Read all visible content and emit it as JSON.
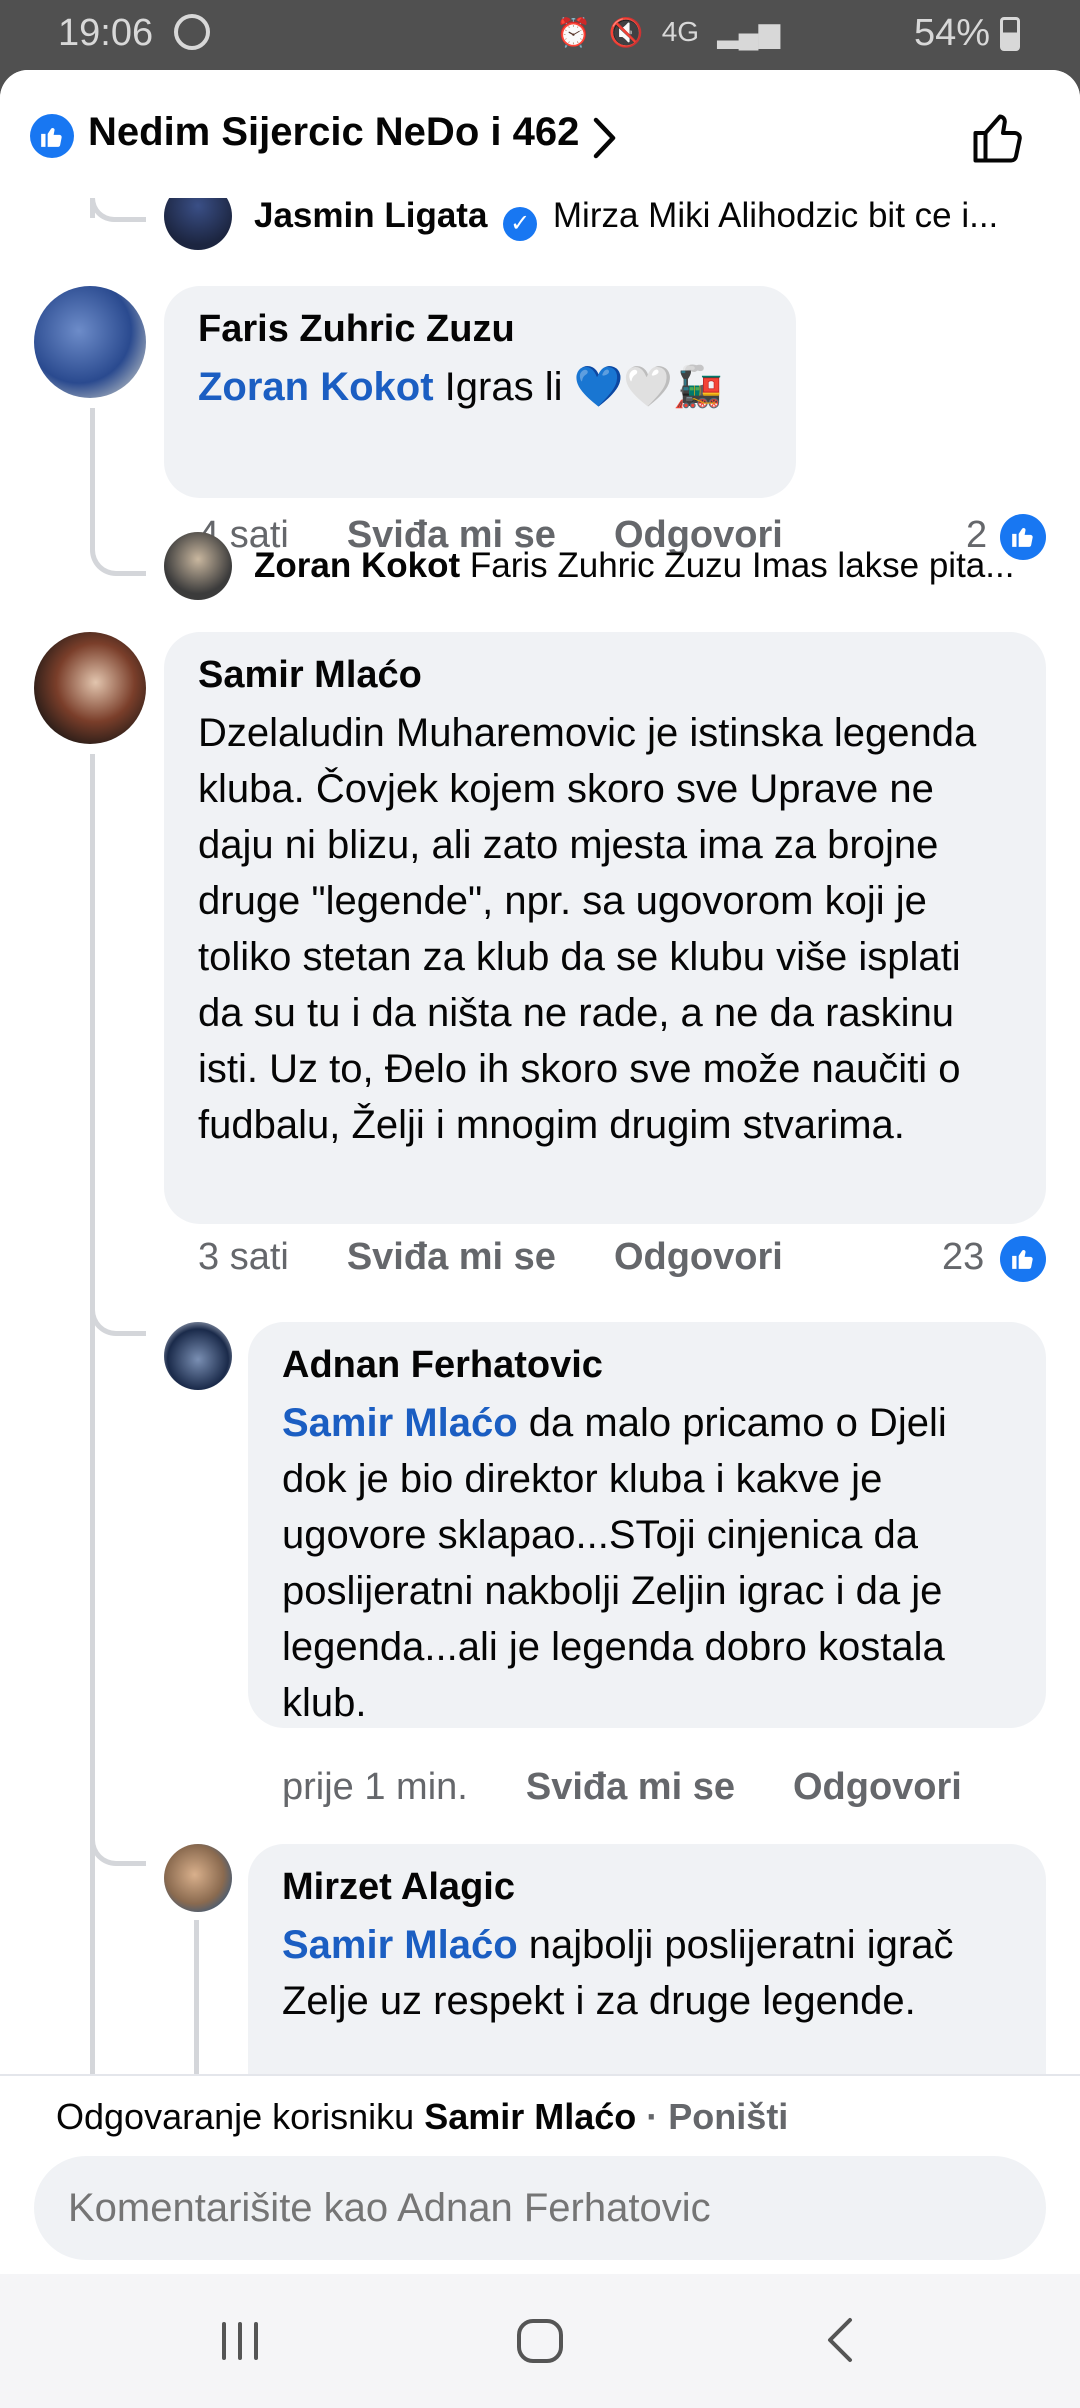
{
  "status": {
    "time": "19:06",
    "network": "4G",
    "battery": "54%"
  },
  "header": {
    "title": "Nedim Sijercic NeDo i 462"
  },
  "comments": {
    "c0": {
      "author": "Jasmin Ligata",
      "preview": "Mirza Miki Alihodzic  bit ce i..."
    },
    "c1": {
      "author": "Faris Zuhric Zuzu",
      "mention": "Zoran Kokot",
      "text": " Igras li 💙🤍🚂",
      "time": "4 sati",
      "like": "Sviđa mi se",
      "reply": "Odgovori",
      "reactions": "2"
    },
    "c1r": {
      "author": "Zoran Kokot",
      "preview": "Faris Zuhric Zuzu Imas lakse pita..."
    },
    "c2": {
      "author": "Samir Mlaćo",
      "text": "Dzelaludin Muharemovic je istinska legenda kluba. Čovjek kojem skoro sve Uprave ne daju ni blizu, ali zato mjesta ima za brojne druge \"legende\", npr. sa ugovorom koji je toliko stetan za klub da se klubu više isplati da su tu i da ništa ne rade, a ne da raskinu isti. Uz to, Đelo ih skoro sve može naučiti o fudbalu, Želji i mnogim drugim stvarima.",
      "time": "3 sati",
      "like": "Sviđa mi se",
      "reply": "Odgovori",
      "reactions": "23"
    },
    "c3": {
      "author": "Adnan Ferhatovic",
      "mention": "Samir Mlaćo",
      "text": " da malo pricamo o Djeli dok je bio direktor kluba i kakve je ugovore sklapao...SToji cinjenica da poslijeratni nakbolji Zeljin igrac i da je legenda...ali je legenda dobro kostala klub.",
      "time": "prije 1 min.",
      "like": "Sviđa mi se",
      "reply": "Odgovori"
    },
    "c4": {
      "author": "Mirzet Alagic",
      "mention": "Samir Mlaćo",
      "text": " najbolji poslijeratni igrač Zelje uz respekt i za druge legende."
    }
  },
  "replybar": {
    "prefix": "Odgovaranje korisniku ",
    "target": "Samir Mlaćo",
    "sep": " · ",
    "cancel": "Poništi",
    "placeholder": "Komentarišite kao Adnan Ferhatovic"
  }
}
